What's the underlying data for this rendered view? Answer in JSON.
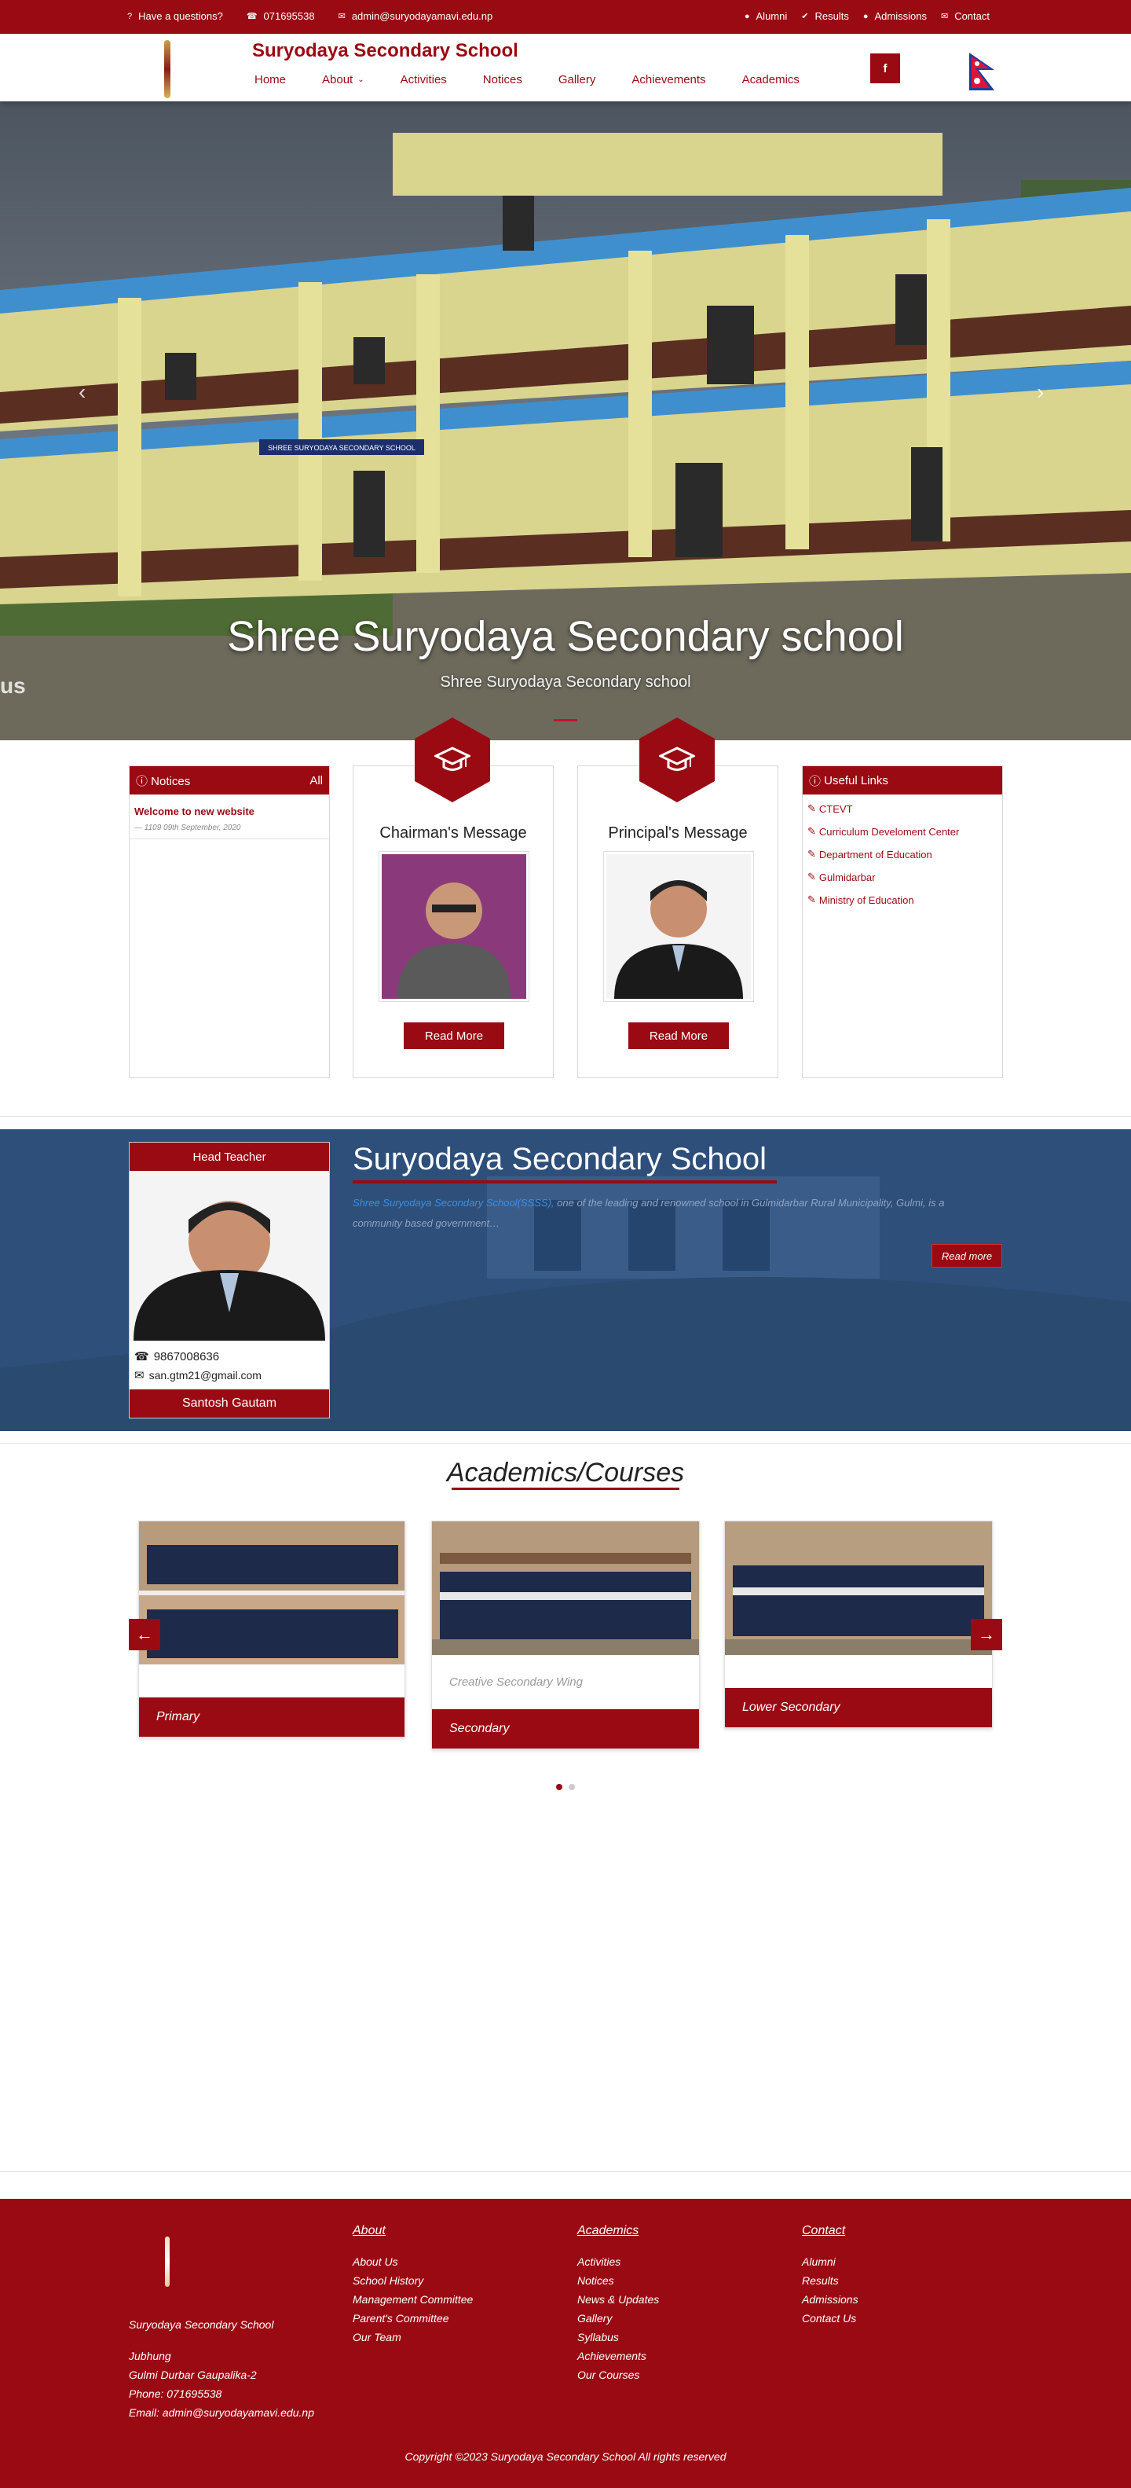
{
  "topbar": {
    "questions": "Have a questions?",
    "phone": "071695538",
    "email": "admin@suryodayamavi.edu.np",
    "links": [
      "Alumni",
      "Results",
      "Admissions",
      "Contact"
    ]
  },
  "header": {
    "brand": "Suryodaya Secondary School",
    "nav": [
      "Home",
      "About",
      "Activities",
      "Notices",
      "Gallery",
      "Achievements",
      "Academics"
    ],
    "facebook": "f"
  },
  "hero": {
    "title": "Shree Suryodaya Secondary school",
    "subtitle": "Shree Suryodaya Secondary school",
    "edge_text": "us",
    "sign_text": "SHREE SURYODAYA SECONDARY SCHOOL"
  },
  "notices": {
    "heading": "Notices",
    "all": "All",
    "items": [
      {
        "title": "Welcome to new website",
        "date": "1109 09th September, 2020"
      }
    ]
  },
  "chairman": {
    "title": "Chairman's Message",
    "button": "Read More"
  },
  "principal": {
    "title": "Principal's Message",
    "button": "Read More"
  },
  "useful_links": {
    "heading": "Useful Links",
    "items": [
      "CTEVT",
      "Curriculum Develoment Center",
      "Department of Education",
      "Gulmidarbar",
      "Ministry of Education"
    ]
  },
  "head_teacher": {
    "heading": "Head Teacher",
    "phone": "9867008636",
    "email": "san.gtm21@gmail.com",
    "name": "Santosh Gautam"
  },
  "about_school": {
    "title": "Suryodaya Secondary School",
    "desc_highlight": "Shree Suryodaya Secondary School(SSSS),",
    "desc_rest": " one of the leading and renowned school in Gulmidarbar Rural Municipality, Gulmi, is a community based government…",
    "button": "Read more"
  },
  "academics": {
    "title": "Academics/Courses",
    "courses": [
      {
        "label": "Primary",
        "sub": ""
      },
      {
        "label": "Secondary",
        "sub": "Creative Secondary Wing"
      },
      {
        "label": "Lower Secondary",
        "sub": ""
      }
    ],
    "prev": "←",
    "next": "→"
  },
  "footer": {
    "school_name": "Suryodaya Secondary School",
    "address_lines": [
      "Jubhung",
      "Gulmi Durbar Gaupalika-2",
      "Phone: 071695538",
      "Email: admin@suryodayamavi.edu.np"
    ],
    "about": {
      "heading": "About",
      "items": [
        "About Us",
        "School History",
        "Management Committee",
        "Parent's Committee",
        "Our Team"
      ]
    },
    "academics": {
      "heading": "Academics",
      "items": [
        "Activities",
        "Notices",
        "News & Updates",
        "Gallery",
        "Syllabus",
        "Achievements",
        "Our Courses"
      ]
    },
    "contact": {
      "heading": "Contact",
      "items": [
        "Alumni",
        "Results",
        "Admissions",
        "Contact Us"
      ]
    },
    "copyright": "Copyright ©2023 Suryodaya Secondary School All rights reserved"
  },
  "colors": {
    "brand": "#9a0a12",
    "blue_section": "#2d4f7a"
  }
}
